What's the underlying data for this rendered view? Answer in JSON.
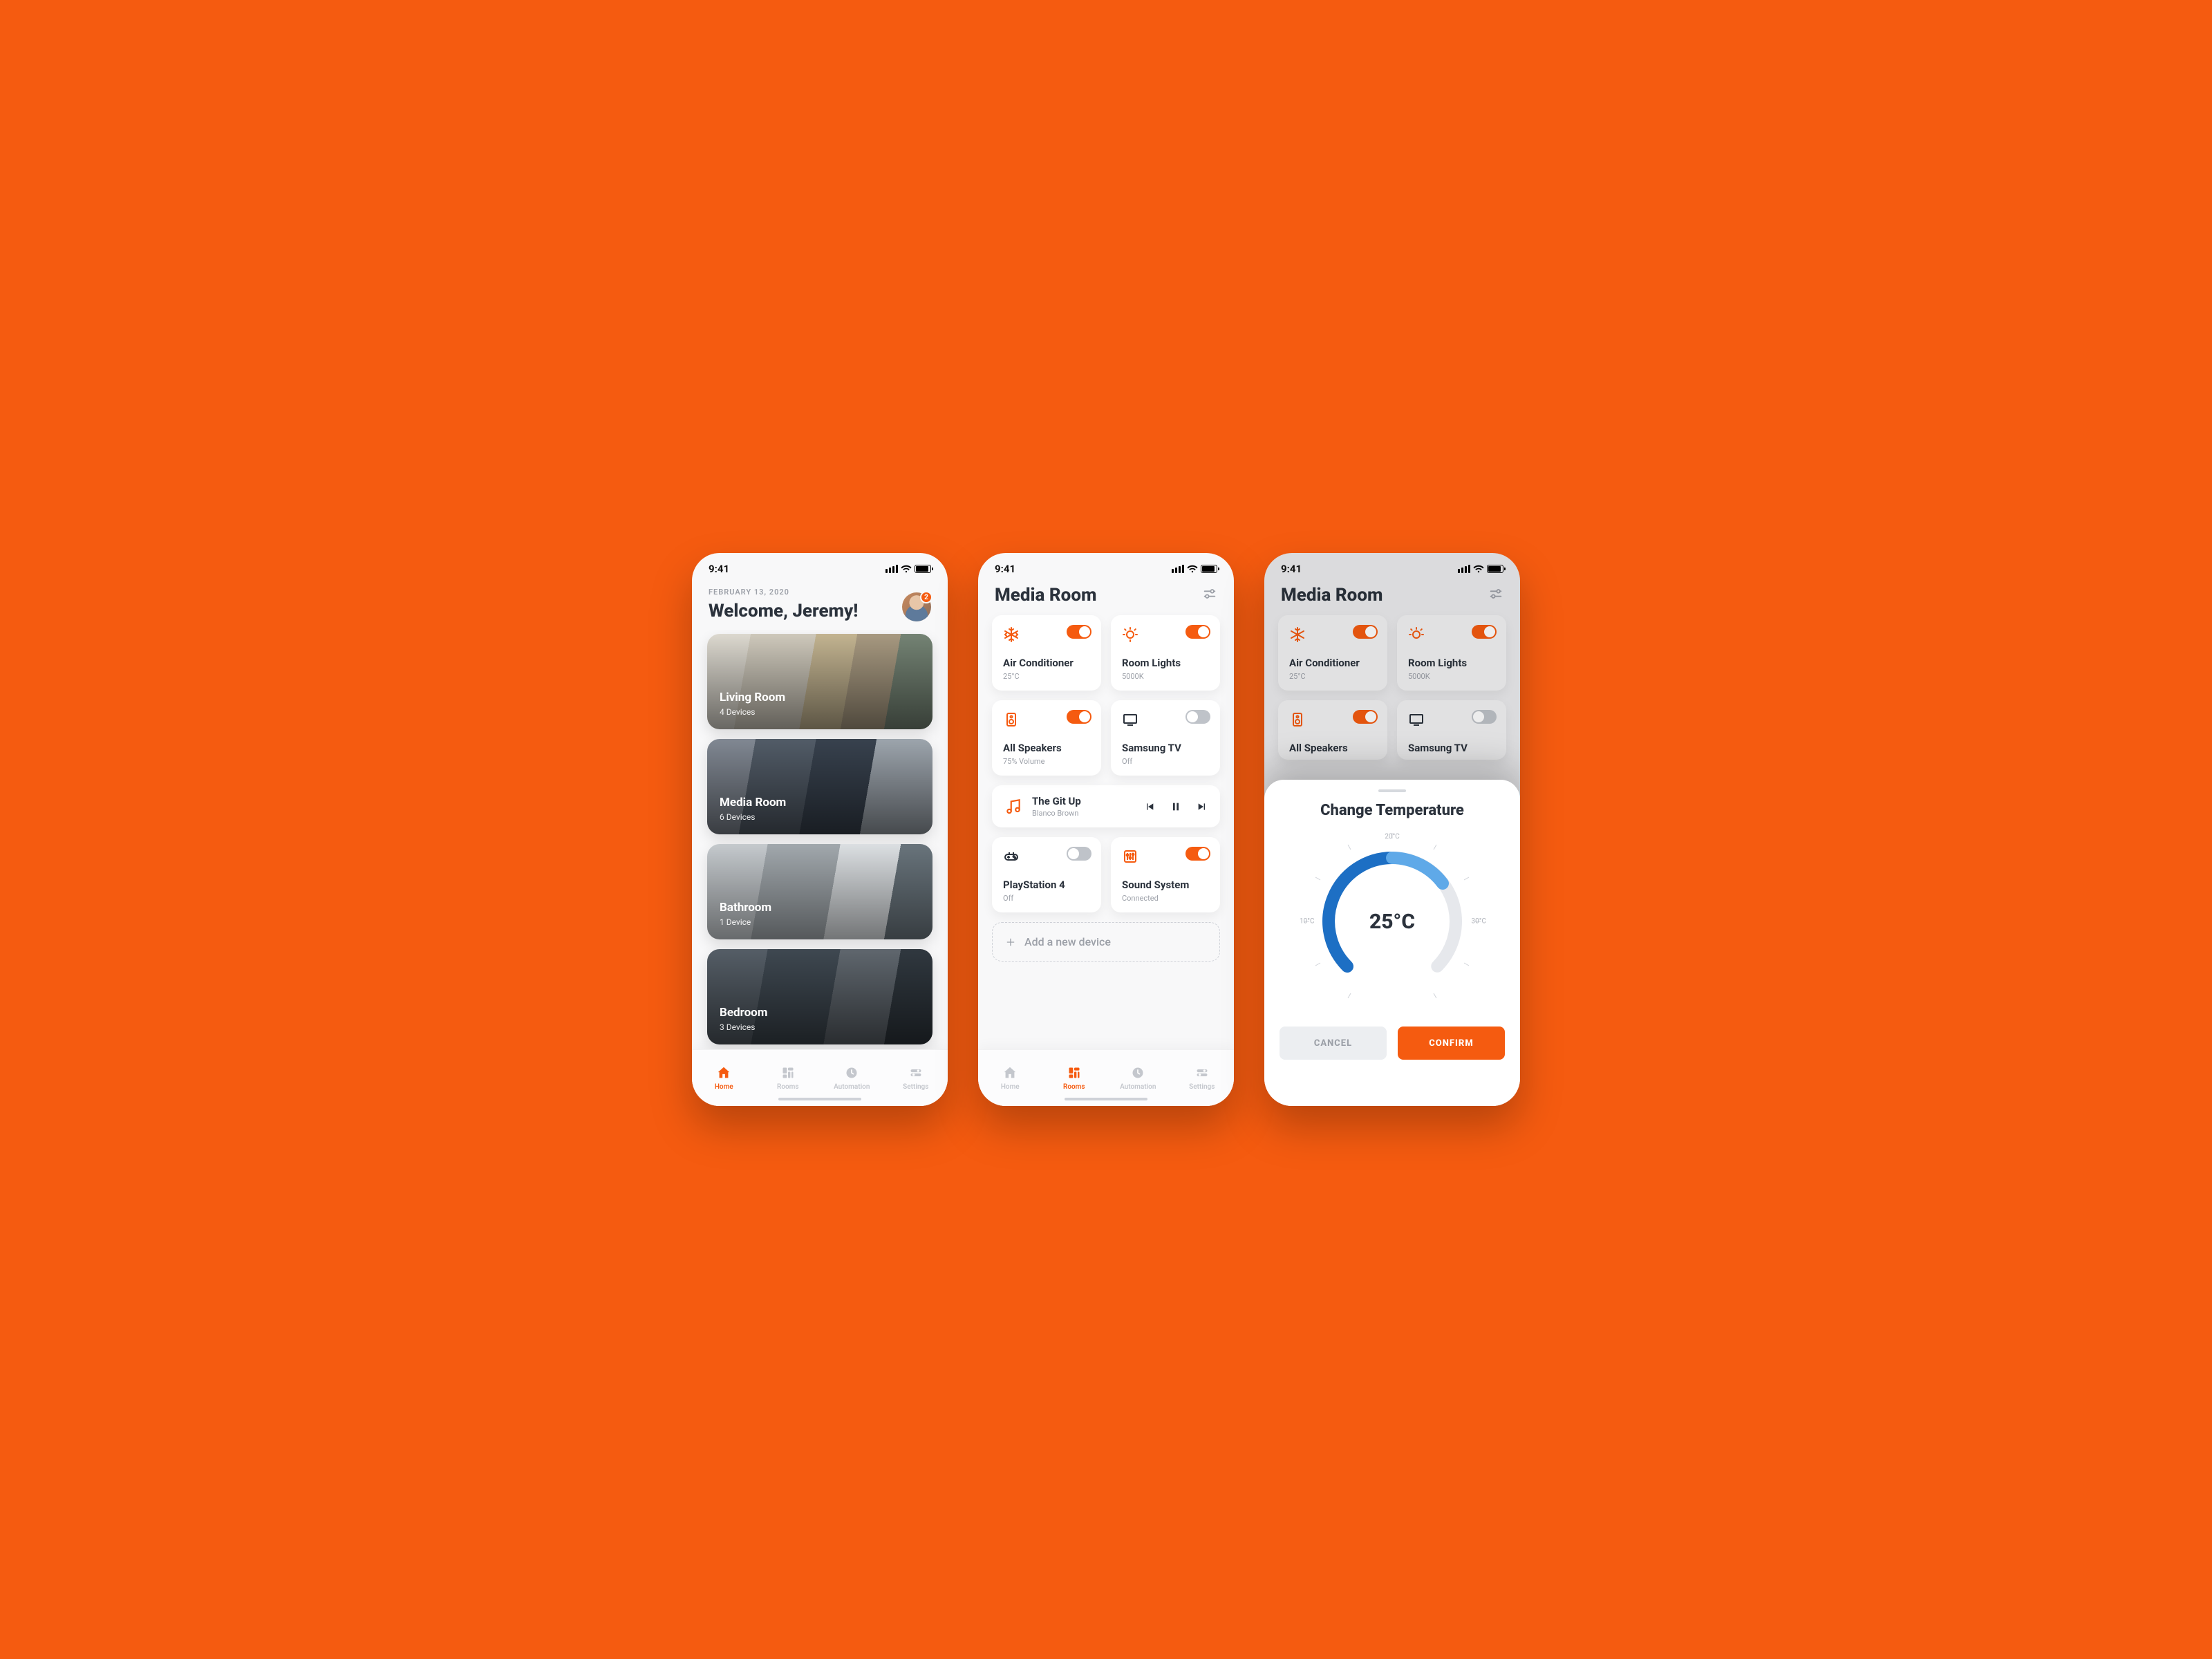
{
  "status": {
    "time": "9:41"
  },
  "screen1": {
    "date": "FEBRUARY 13, 2020",
    "welcome": "Welcome, Jeremy!",
    "badge": "2",
    "rooms": [
      {
        "name": "Living Room",
        "sub": "4 Devices"
      },
      {
        "name": "Media Room",
        "sub": "6 Devices"
      },
      {
        "name": "Bathroom",
        "sub": "1 Device"
      },
      {
        "name": "Bedroom",
        "sub": "3 Devices"
      }
    ]
  },
  "nav": {
    "home": "Home",
    "rooms": "Rooms",
    "automation": "Automation",
    "settings": "Settings"
  },
  "screen2": {
    "title": "Media Room",
    "devices": {
      "ac": {
        "name": "Air Conditioner",
        "sub": "25°C",
        "on": true
      },
      "lights": {
        "name": "Room Lights",
        "sub": "5000K",
        "on": true
      },
      "spk": {
        "name": "All Speakers",
        "sub": "75% Volume",
        "on": true
      },
      "tv": {
        "name": "Samsung TV",
        "sub": "Off",
        "on": false
      },
      "ps": {
        "name": "PlayStation 4",
        "sub": "Off",
        "on": false
      },
      "ss": {
        "name": "Sound System",
        "sub": "Connected",
        "on": true
      }
    },
    "music": {
      "title": "The Git Up",
      "artist": "Blanco Brown"
    },
    "add": "Add a new device"
  },
  "screen3": {
    "title": "Media Room",
    "modal": {
      "title": "Change Temperature",
      "value": "25°C",
      "labels": {
        "top": "20°C",
        "left": "10°C",
        "right": "30°C"
      },
      "cancel": "CANCEL",
      "confirm": "CONFIRM"
    }
  }
}
